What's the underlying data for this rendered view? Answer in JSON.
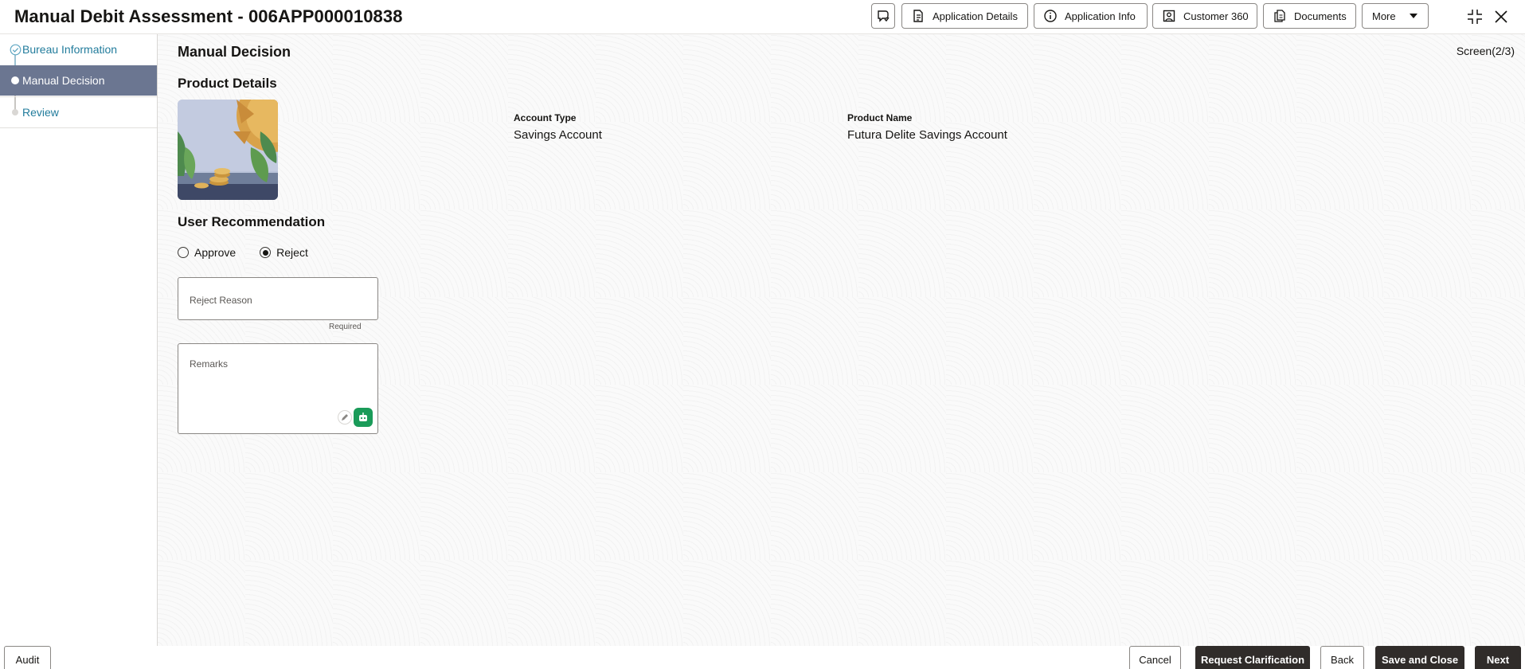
{
  "header": {
    "title": "Manual Debit Assessment - 006APP000010838",
    "buttons": {
      "chat_icon": "chat-icon",
      "application_details": "Application Details",
      "application_info": "Application Info",
      "customer_360": "Customer 360",
      "documents": "Documents",
      "more": "More"
    }
  },
  "sidebar": {
    "steps": [
      {
        "label": "Bureau Information",
        "state": "completed"
      },
      {
        "label": "Manual Decision",
        "state": "active"
      },
      {
        "label": "Review",
        "state": "pending"
      }
    ]
  },
  "main": {
    "title": "Manual Decision",
    "screen_indicator": "Screen(2/3)",
    "product_details": {
      "heading": "Product Details",
      "account_type_label": "Account Type",
      "account_type_value": "Savings Account",
      "product_name_label": "Product Name",
      "product_name_value": "Futura Delite Savings Account"
    },
    "user_recommendation": {
      "heading": "User Recommendation",
      "options": [
        "Approve",
        "Reject"
      ],
      "selected": "Reject",
      "reject_reason_placeholder": "Reject Reason",
      "reject_reason_helper": "Required",
      "remarks_placeholder": "Remarks"
    }
  },
  "footer": {
    "audit": "Audit",
    "cancel": "Cancel",
    "request_clarification": "Request Clarification",
    "back": "Back",
    "save_and_close": "Save and Close",
    "next": "Next"
  },
  "colors": {
    "active_step_bg": "#6b7691",
    "link": "#227c9c",
    "primary_button": "#302c2a",
    "assistant_green": "#1a9b59"
  }
}
